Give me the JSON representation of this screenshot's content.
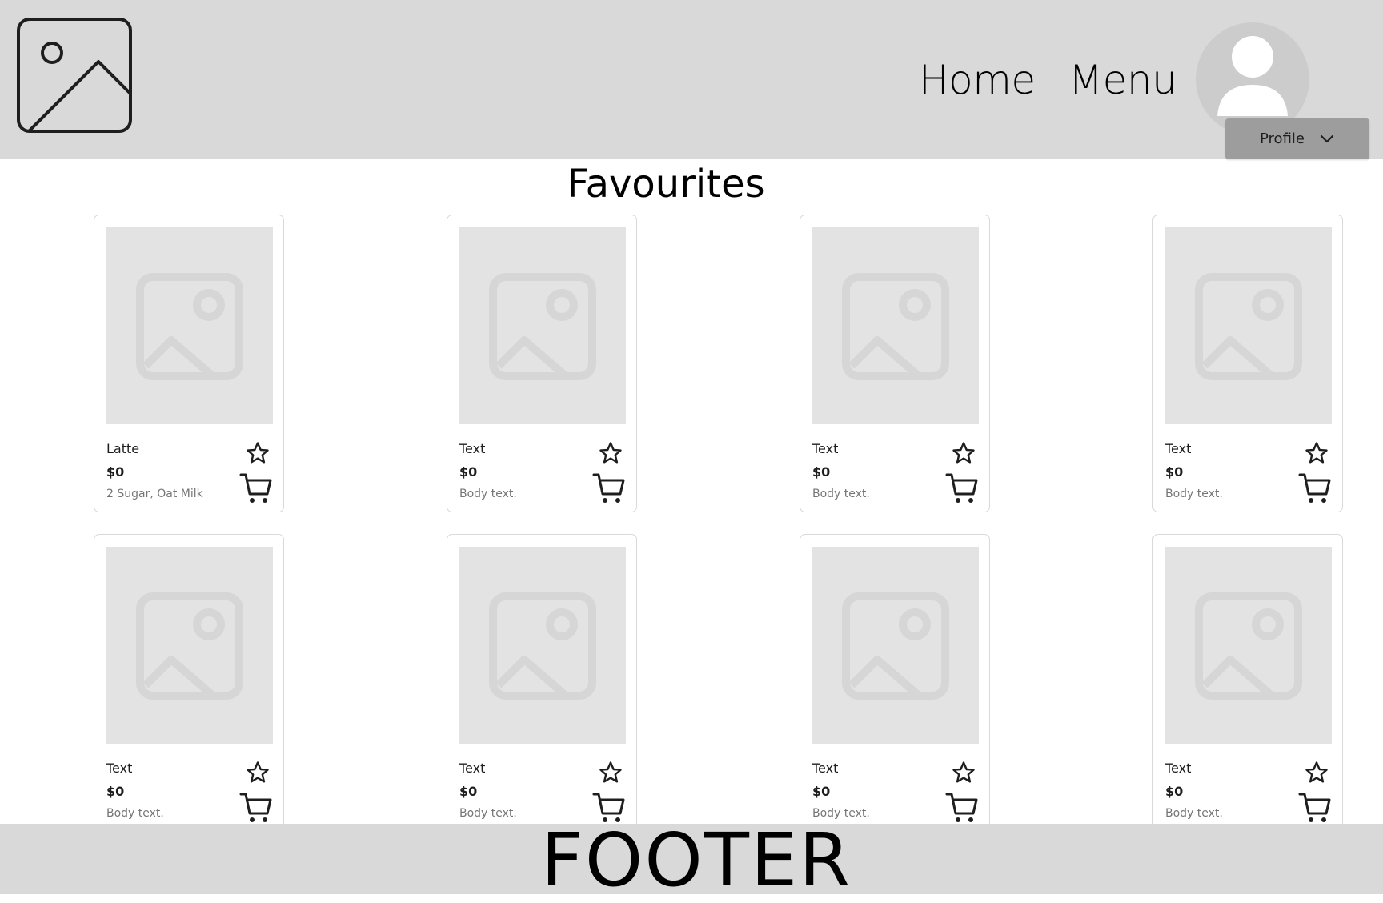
{
  "header": {
    "nav": [
      {
        "label": "Home"
      },
      {
        "label": "Menu"
      }
    ],
    "profile": {
      "label": "Profile"
    }
  },
  "page": {
    "title": "Favourites"
  },
  "cards": [
    {
      "title": "Latte",
      "price": "$0",
      "desc": "2 Sugar, Oat Milk"
    },
    {
      "title": "Text",
      "price": "$0",
      "desc": "Body text."
    },
    {
      "title": "Text",
      "price": "$0",
      "desc": "Body text."
    },
    {
      "title": "Text",
      "price": "$0",
      "desc": "Body text."
    },
    {
      "title": "Text",
      "price": "$0",
      "desc": "Body text."
    },
    {
      "title": "Text",
      "price": "$0",
      "desc": "Body text."
    },
    {
      "title": "Text",
      "price": "$0",
      "desc": "Body text."
    },
    {
      "title": "Text",
      "price": "$0",
      "desc": "Body text."
    }
  ],
  "footer": {
    "label": "FOOTER"
  },
  "colors": {
    "header_bg": "#d9d9d9",
    "placeholder_bg": "#e3e3e3",
    "profile_button_bg": "#9d9d9d"
  }
}
